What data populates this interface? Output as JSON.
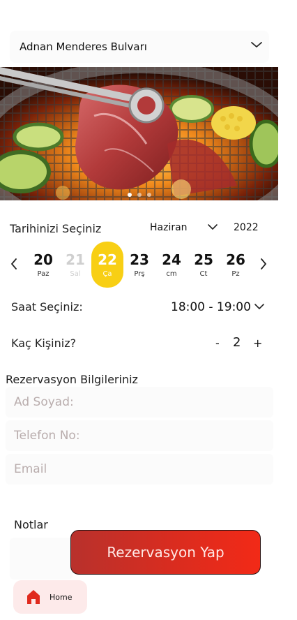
{
  "location": {
    "selected": "Adnan Menderes Bulvarı",
    "icon": "chevron-down-icon"
  },
  "hero": {
    "image": "grilled-meat-photo",
    "slides": 3,
    "active_slide": 1
  },
  "date_picker": {
    "label": "Tarihinizi Seçiniz",
    "month": "Haziran",
    "year": "2022",
    "prev_icon": "chevron-left-icon",
    "next_icon": "chevron-right-icon",
    "days": [
      {
        "num": "20",
        "weekday": "Paz",
        "state": "normal"
      },
      {
        "num": "21",
        "weekday": "Sal",
        "state": "disabled"
      },
      {
        "num": "22",
        "weekday": "Ça",
        "state": "selected"
      },
      {
        "num": "23",
        "weekday": "Prş",
        "state": "normal"
      },
      {
        "num": "24",
        "weekday": "cm",
        "state": "normal"
      },
      {
        "num": "25",
        "weekday": "Ct",
        "state": "normal"
      },
      {
        "num": "26",
        "weekday": "Pz",
        "state": "normal"
      }
    ],
    "selected_color": "#f8cf14"
  },
  "time": {
    "label": "Saat Seçiniz:",
    "value": "18:00 - 19:00"
  },
  "guests": {
    "label": "Kaç Kişiniz?",
    "minus": "-",
    "count": "2",
    "plus": "+"
  },
  "reservation_info": {
    "heading": "Rezervasyon Bilgileriniz",
    "name_placeholder": "Ad Soyad:",
    "phone_placeholder": "Telefon No:",
    "email_placeholder": "Email"
  },
  "notes": {
    "label": "Notlar"
  },
  "submit": {
    "label": "Rezervasyon Yap",
    "gradient": [
      "#b8312c",
      "#f22a17"
    ]
  },
  "bottom_nav": {
    "home_label": "Home",
    "home_icon": "home-icon",
    "icon_color": "#e02a1e",
    "tab_bg": "#fdeaea"
  }
}
